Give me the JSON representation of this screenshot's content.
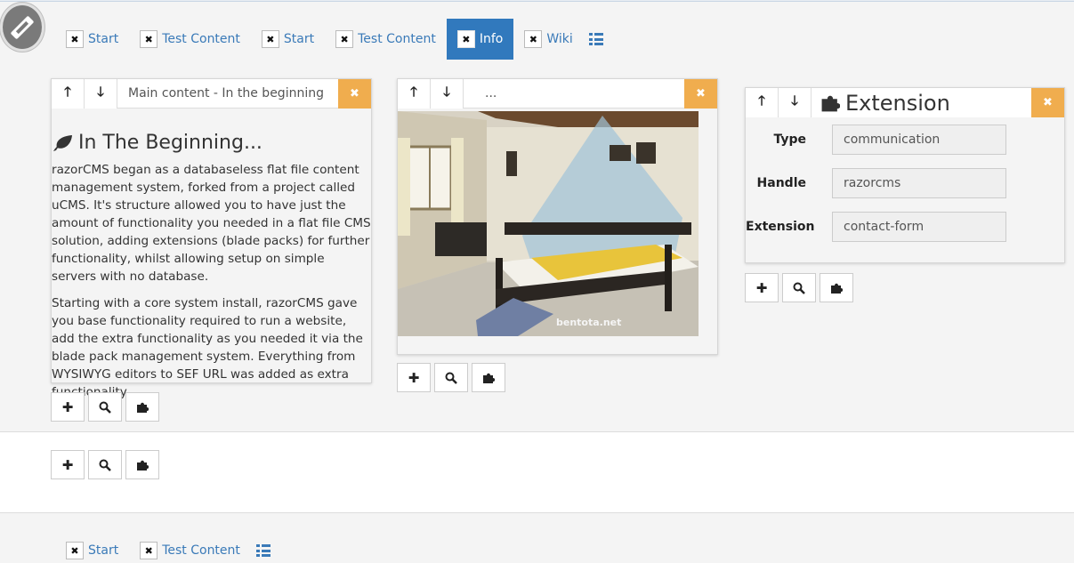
{
  "top_menu": {
    "items": [
      {
        "label": "Start",
        "active": false
      },
      {
        "label": "Test Content",
        "active": false
      },
      {
        "label": "Start",
        "active": false
      },
      {
        "label": "Test Content",
        "active": false
      },
      {
        "label": "Info",
        "active": true
      },
      {
        "label": "Wiki",
        "active": false
      }
    ]
  },
  "panel_main": {
    "title": "Main content - In the beginning",
    "heading": "In The Beginning...",
    "paragraphs": [
      "razorCMS began as a databaseless flat file content management system, forked from a project called uCMS. It's structure allowed you to have just the amount of functionality you needed in a flat file CMS solution, adding extensions (blade packs) for further functionality, whilst allowing setup on simple servers with no database.",
      "Starting with a core system install, razorCMS gave you base functionality required to run a website, add the extra functionality as you needed it via the blade pack management system. Everything from WYSIWYG editors to SEF URL was added as extra functionality."
    ]
  },
  "panel_image": {
    "title": "...",
    "watermark": "bentota.net"
  },
  "panel_ext": {
    "title": "Extension",
    "fields": [
      {
        "label": "Type",
        "value": "communication"
      },
      {
        "label": "Handle",
        "value": "razorcms"
      },
      {
        "label": "Extension",
        "value": "contact-form"
      }
    ]
  },
  "bottom_menu": {
    "items": [
      {
        "label": "Start"
      },
      {
        "label": "Test Content"
      }
    ]
  },
  "colors": {
    "accent": "#3179bd",
    "link": "#3a7ab8",
    "close_button": "#f0ad4e"
  },
  "icons": {
    "move_up": "arrow-up-icon",
    "move_down": "arrow-down-icon",
    "close": "close-icon",
    "add": "plus-icon",
    "search": "search-icon",
    "extension": "puzzle-icon"
  }
}
